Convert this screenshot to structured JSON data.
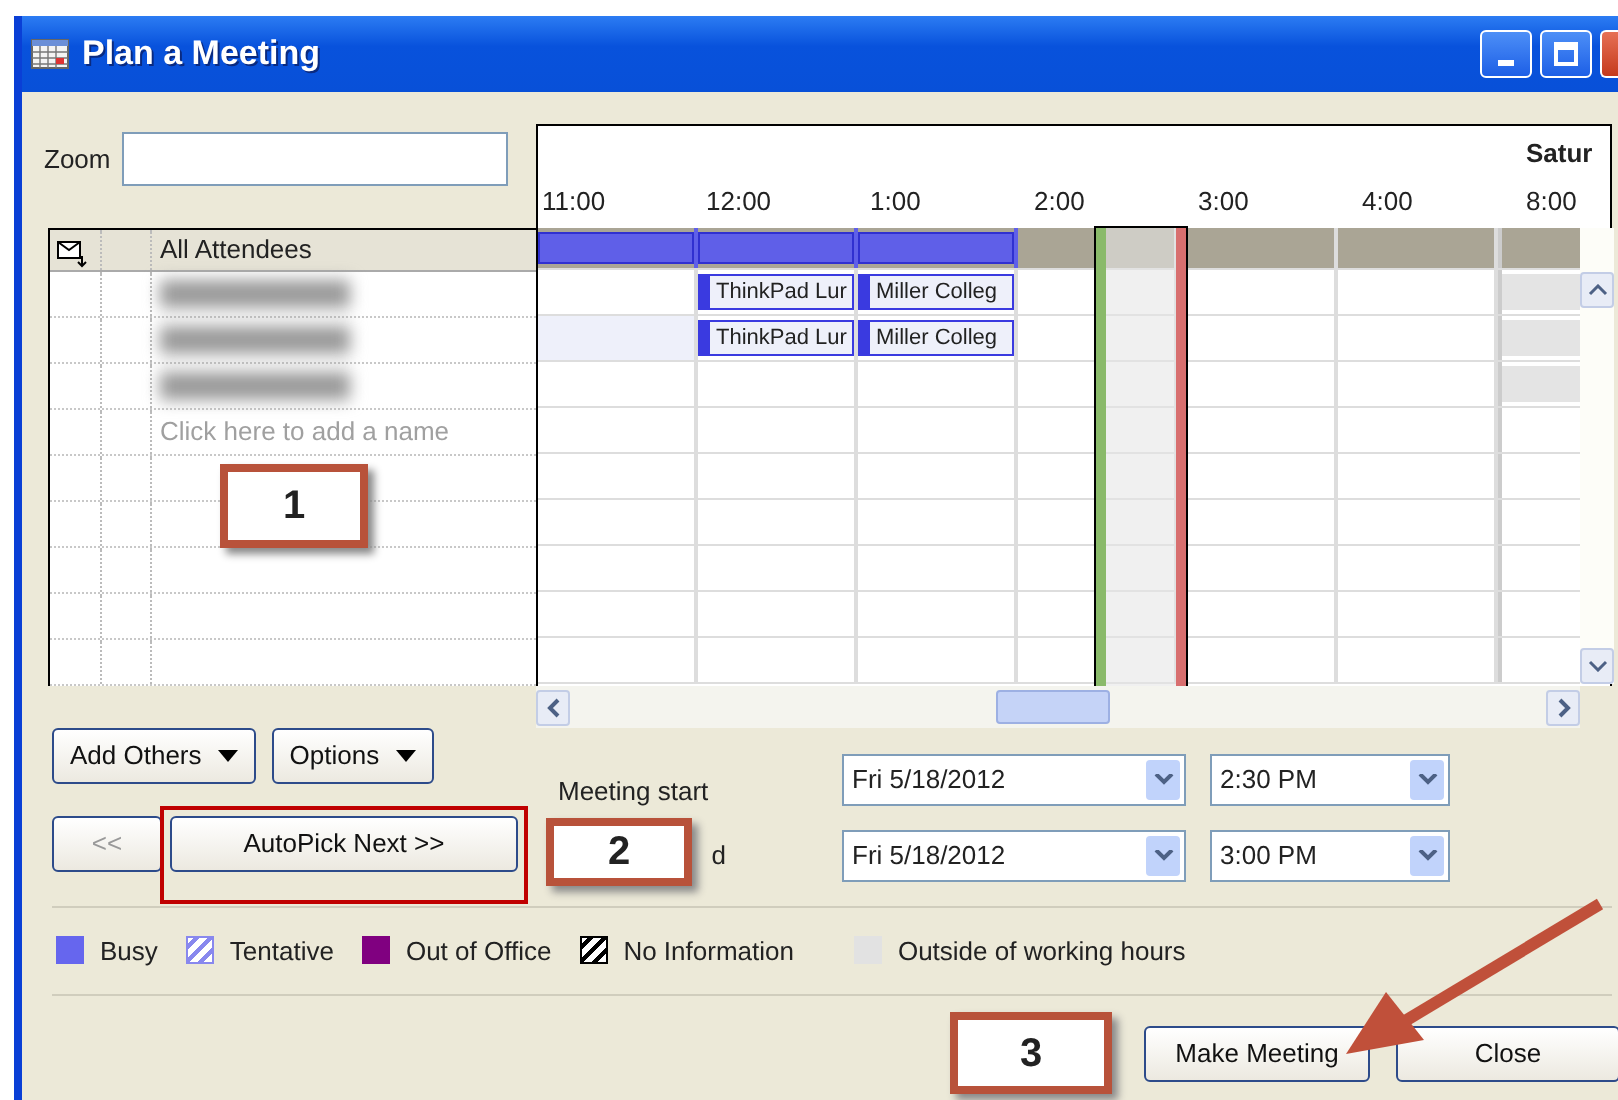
{
  "window": {
    "title": "Plan a Meeting"
  },
  "zoom": {
    "label": "Zoom"
  },
  "timeline": {
    "day": "Satur",
    "times": [
      "11:00",
      "12:00",
      "1:00",
      "2:00",
      "3:00",
      "4:00",
      "8:00"
    ]
  },
  "attendees": {
    "header": "All Attendees",
    "rows": [
      {
        "kind": "summary",
        "cells": [
          {
            "kind": "busy"
          },
          {
            "kind": "busy"
          },
          {
            "kind": "busy"
          },
          {
            "kind": "free"
          },
          {
            "kind": "free"
          },
          {
            "kind": "free"
          },
          {
            "kind": "free"
          }
        ]
      },
      {
        "kind": "blurred",
        "cells": [
          {
            "kind": "free"
          },
          {
            "kind": "busy",
            "label": "ThinkPad Lur"
          },
          {
            "kind": "busy",
            "label": "Miller Colleg"
          },
          {
            "kind": "free"
          },
          {
            "kind": "free"
          },
          {
            "kind": "free"
          },
          {
            "kind": "outside"
          }
        ]
      },
      {
        "kind": "blurred",
        "cells": [
          {
            "kind": "shaded"
          },
          {
            "kind": "busy",
            "label": "ThinkPad Lur"
          },
          {
            "kind": "busy",
            "label": "Miller Colleg"
          },
          {
            "kind": "free"
          },
          {
            "kind": "free"
          },
          {
            "kind": "free"
          },
          {
            "kind": "outside"
          }
        ]
      },
      {
        "kind": "blurred",
        "cells": [
          {
            "kind": "free"
          },
          {
            "kind": "free"
          },
          {
            "kind": "free"
          },
          {
            "kind": "free"
          },
          {
            "kind": "free"
          },
          {
            "kind": "free"
          },
          {
            "kind": "outside"
          }
        ]
      },
      {
        "kind": "add",
        "placeholder": "Click here to add a name"
      },
      {
        "kind": "empty"
      },
      {
        "kind": "empty"
      },
      {
        "kind": "empty"
      },
      {
        "kind": "empty"
      },
      {
        "kind": "empty"
      }
    ]
  },
  "buttons": {
    "add_others": "Add Others",
    "options": "Options",
    "previous": "<<",
    "autopick": "AutoPick Next >>"
  },
  "meeting": {
    "start_label": "Meeting start",
    "end_label": "d",
    "start_date": "Fri 5/18/2012",
    "start_time": "2:30 PM",
    "end_date": "Fri 5/18/2012",
    "end_time": "3:00 PM"
  },
  "legend": [
    {
      "kind": "solid",
      "label": "Busy",
      "color": "#6666ee"
    },
    {
      "kind": "hatched",
      "label": "Tentative",
      "color": "#8888ee"
    },
    {
      "kind": "solid",
      "label": "Out of Office",
      "color": "#800080"
    },
    {
      "kind": "hatched",
      "label": "No Information",
      "color": "#000000"
    },
    {
      "kind": "solid",
      "label": "Outside of working hours",
      "color": "#e2e2e2"
    }
  ],
  "actions": {
    "make_meeting": "Make Meeting",
    "close": "Close"
  },
  "callouts": [
    "1",
    "2",
    "3"
  ]
}
